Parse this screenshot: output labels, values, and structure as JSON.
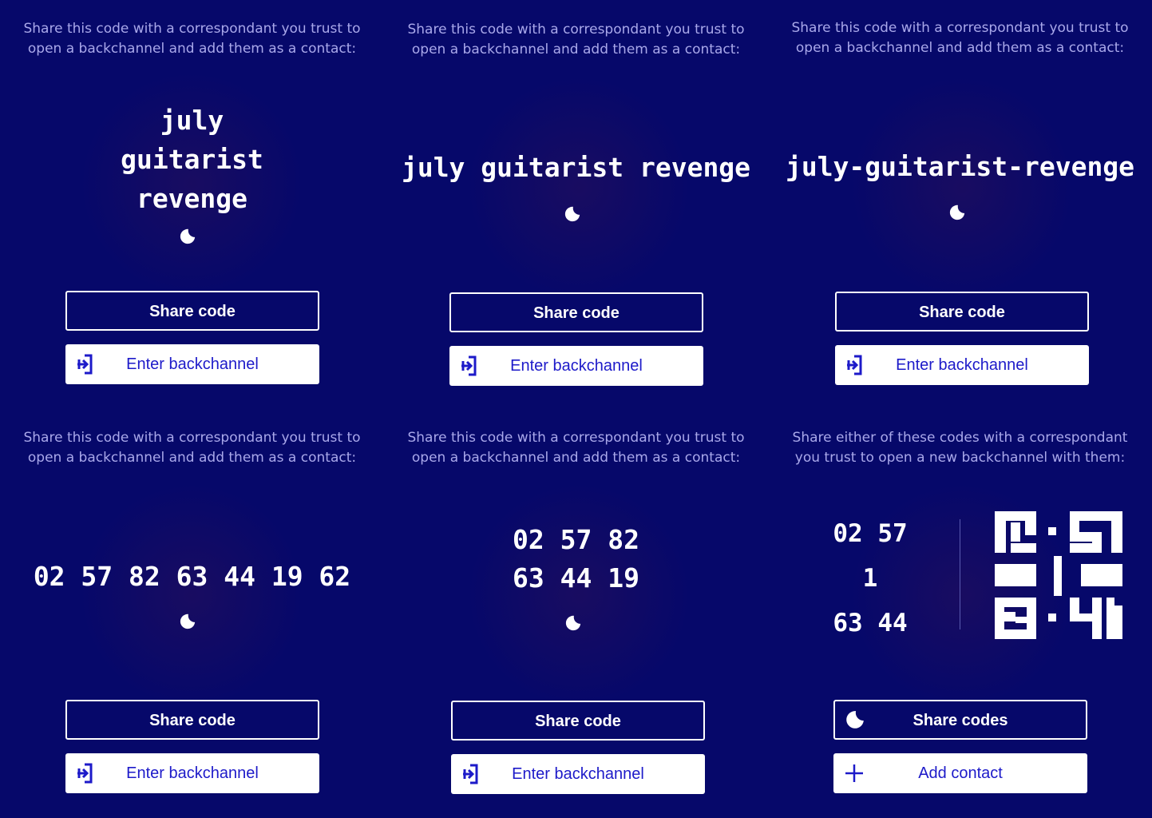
{
  "panels": [
    {
      "intro": "Share this code with a correspondant you trust to open a backchannel and add them as a contact:",
      "words": [
        "july",
        "guitarist",
        "revenge"
      ],
      "share_label": "Share code",
      "enter_label": "Enter backchannel"
    },
    {
      "intro": "Share this code with a correspondant you trust to open a backchannel and add them as a contact:",
      "code_line": "july guitarist revenge",
      "share_label": "Share code",
      "enter_label": "Enter backchannel"
    },
    {
      "intro": "Share this code with a correspondant you trust to open a backchannel and add them as a contact:",
      "code_line": "july-guitarist-revenge",
      "share_label": "Share code",
      "enter_label": "Enter backchannel"
    },
    {
      "intro": "Share this code with a correspondant you trust to open a backchannel and add them as a contact:",
      "code_line": "02 57 82 63 44 19 62",
      "share_label": "Share code",
      "enter_label": "Enter backchannel"
    },
    {
      "intro": "Share this code with a correspondant you trust to open a backchannel and add them as a contact:",
      "rows": [
        "02 57 82",
        "63 44 19"
      ],
      "share_label": "Share code",
      "enter_label": "Enter backchannel"
    },
    {
      "intro": "Share either of these codes with a correspondant you trust to open a new backchannel with them:",
      "rows": [
        "02 57",
        "1",
        "63 44"
      ],
      "share_label": "Share codes",
      "add_label": "Add contact"
    }
  ],
  "icons": {
    "status": "moon-icon",
    "enter": "enter-backchannel-icon",
    "add": "plus-icon"
  },
  "colors": {
    "background": "#06086a",
    "intro_text": "#a9a8ea",
    "accent": "#1d1ac9",
    "foreground": "#ffffff"
  }
}
